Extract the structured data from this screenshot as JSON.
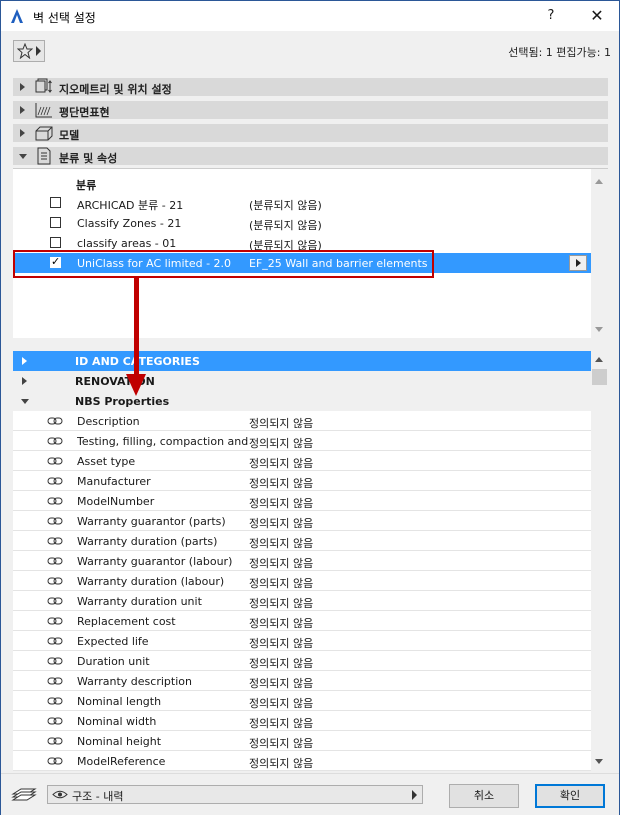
{
  "window": {
    "title": "벽 선택 설정",
    "help_label": "?",
    "close_label": "✕"
  },
  "header": {
    "selection_info": "선택됨: 1 편집가능: 1"
  },
  "panels": [
    {
      "label": "지오메트리 및 위치 설정",
      "expanded": false
    },
    {
      "label": "평단면표현",
      "expanded": false
    },
    {
      "label": "모델",
      "expanded": false
    },
    {
      "label": "분류 및 속성",
      "expanded": true
    }
  ],
  "classification": {
    "header": "분류",
    "rows": [
      {
        "name": "ARCHICAD 분류 - 21",
        "value": "(분류되지 않음)",
        "checked": false
      },
      {
        "name": "Classify Zones - 21",
        "value": "(분류되지 않음)",
        "checked": false
      },
      {
        "name": "classify areas - 01",
        "value": "(분류되지 않음)",
        "checked": false
      },
      {
        "name": "UniClass for AC limited - 2.0",
        "value": "EF_25 Wall and barrier elements",
        "checked": true
      }
    ]
  },
  "properties": {
    "groups": [
      {
        "label": "ID AND CATEGORIES",
        "expanded": false
      },
      {
        "label": "RENOVATION",
        "expanded": false
      },
      {
        "label": "NBS Properties",
        "expanded": true
      }
    ],
    "rows": [
      {
        "name": "Description",
        "value": "정의되지 않음"
      },
      {
        "name": "Testing, filling, compaction and...",
        "value": "정의되지 않음"
      },
      {
        "name": "Asset type",
        "value": "정의되지 않음"
      },
      {
        "name": "Manufacturer",
        "value": "정의되지 않음"
      },
      {
        "name": "ModelNumber",
        "value": "정의되지 않음"
      },
      {
        "name": "Warranty guarantor (parts)",
        "value": "정의되지 않음"
      },
      {
        "name": "Warranty duration (parts)",
        "value": "정의되지 않음"
      },
      {
        "name": "Warranty guarantor (labour)",
        "value": "정의되지 않음"
      },
      {
        "name": "Warranty duration (labour)",
        "value": "정의되지 않음"
      },
      {
        "name": "Warranty duration unit",
        "value": "정의되지 않음"
      },
      {
        "name": "Replacement cost",
        "value": "정의되지 않음"
      },
      {
        "name": "Expected life",
        "value": "정의되지 않음"
      },
      {
        "name": "Duration unit",
        "value": "정의되지 않음"
      },
      {
        "name": "Warranty description",
        "value": "정의되지 않음"
      },
      {
        "name": "Nominal length",
        "value": "정의되지 않음"
      },
      {
        "name": "Nominal width",
        "value": "정의되지 않음"
      },
      {
        "name": "Nominal height",
        "value": "정의되지 않음"
      },
      {
        "name": "ModelReference",
        "value": "정의되지 않음"
      }
    ]
  },
  "footer": {
    "layer_value": "구조 - 내력",
    "cancel_label": "취소",
    "ok_label": "확인"
  },
  "colors": {
    "selection": "#3399ff",
    "annotation": "#c00000"
  }
}
